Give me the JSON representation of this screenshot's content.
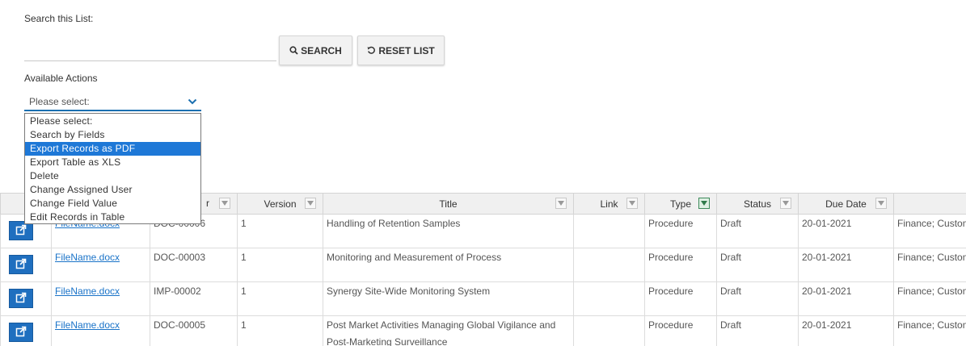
{
  "search": {
    "label": "Search this List:",
    "value": "",
    "search_button": "SEARCH",
    "reset_button": "RESET LIST"
  },
  "actions": {
    "label": "Available Actions",
    "selected": "Please select:",
    "options": [
      "Please select:",
      "Search by Fields",
      "Export Records as PDF",
      "Export Table as XLS",
      "Delete",
      "Change Assigned User",
      "Change Field Value",
      "Edit Records in Table"
    ],
    "highlighted_index": 2
  },
  "table": {
    "columns": [
      {
        "label": ""
      },
      {
        "label": ""
      },
      {
        "label": "r"
      },
      {
        "label": "Version"
      },
      {
        "label": "Title"
      },
      {
        "label": "Link"
      },
      {
        "label": "Type"
      },
      {
        "label": "Status"
      },
      {
        "label": "Due Date"
      },
      {
        "label": ""
      }
    ],
    "rows": [
      {
        "file": "FileName.docx",
        "id": "DOC-00006",
        "version": "1",
        "title": "Handling of Retention Samples",
        "link": "",
        "type": "Procedure",
        "status": "Draft",
        "due": "20-01-2021",
        "dept": "Finance; Customer"
      },
      {
        "file": "FileName.docx",
        "id": "DOC-00003",
        "version": "1",
        "title": "Monitoring and Measurement of Process",
        "link": "",
        "type": "Procedure",
        "status": "Draft",
        "due": "20-01-2021",
        "dept": "Finance; Customer"
      },
      {
        "file": "FileName.docx",
        "id": "IMP-00002",
        "version": "1",
        "title": "Synergy Site-Wide Monitoring System",
        "link": "",
        "type": "Procedure",
        "status": "Draft",
        "due": "20-01-2021",
        "dept": "Finance; Customer"
      },
      {
        "file": "FileName.docx",
        "id": "DOC-00005",
        "version": "1",
        "title": "Post Market Activities Managing Global Vigilance and Post-Marketing Surveillance",
        "link": "",
        "type": "Procedure",
        "status": "Draft",
        "due": "20-01-2021",
        "dept": "Finance; Customer"
      }
    ]
  },
  "colors": {
    "accent": "#1a6fb0",
    "highlight": "#1e78d7",
    "open_button": "#1f6fbf",
    "link": "#1a73c8"
  },
  "icons": {
    "search": "magnifier-icon",
    "reset": "refresh-icon",
    "chevron": "chevron-down-icon",
    "filter": "filter-triangle-icon",
    "open": "external-link-icon"
  }
}
